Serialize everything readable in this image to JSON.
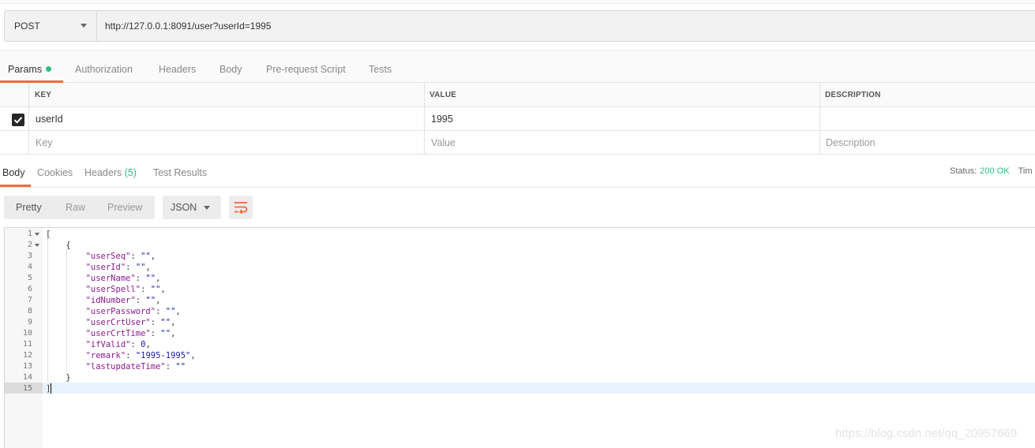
{
  "request": {
    "method": "POST",
    "url": "http://127.0.0.1:8091/user?userId=1995"
  },
  "request_tabs": [
    {
      "label": "Params",
      "active": true,
      "has_dot": true
    },
    {
      "label": "Authorization"
    },
    {
      "label": "Headers"
    },
    {
      "label": "Body"
    },
    {
      "label": "Pre-request Script"
    },
    {
      "label": "Tests"
    }
  ],
  "params_table": {
    "headers": [
      "KEY",
      "VALUE",
      "DESCRIPTION"
    ],
    "rows": [
      {
        "checked": true,
        "key": "userId",
        "value": "1995",
        "description": ""
      }
    ],
    "placeholders": {
      "key": "Key",
      "value": "Value",
      "description": "Description"
    }
  },
  "response_tabs": [
    {
      "label": "Body",
      "active": true
    },
    {
      "label": "Cookies"
    },
    {
      "label": "Headers",
      "count": "(5)"
    },
    {
      "label": "Test Results"
    }
  ],
  "status": {
    "label": "Status:",
    "value": "200 OK",
    "time_label_truncated": "Tim"
  },
  "view_modes": [
    "Pretty",
    "Raw",
    "Preview"
  ],
  "active_view": "Pretty",
  "format": "JSON",
  "editor": {
    "lines": [
      "[",
      "    {",
      "        \"userSeq\": \"\",",
      "        \"userId\": \"\",",
      "        \"userName\": \"\",",
      "        \"userSpell\": \"\",",
      "        \"idNumber\": \"\",",
      "        \"userPassword\": \"\",",
      "        \"userCrtUser\": \"\",",
      "        \"userCrtTime\": \"\",",
      "        \"ifValid\": 0,",
      "        \"remark\": \"1995-1995\",",
      "        \"lastupdateTime\": \"\"",
      "    }",
      "]"
    ],
    "active_line": 15
  },
  "watermark": "https://blog.csdn.net/qq_20957669",
  "colors": {
    "accent": "#f26b3a",
    "success": "#2dbd84",
    "json_key": "#8b1a8b",
    "json_value": "#1a1aa6"
  }
}
